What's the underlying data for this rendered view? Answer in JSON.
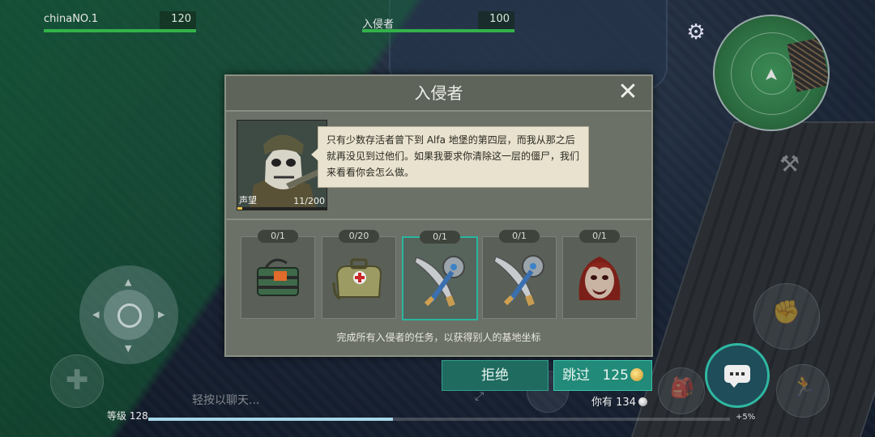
{
  "hud": {
    "player_name": "chinaNO.1",
    "player_hp": "120",
    "enemy_name": "入侵者",
    "enemy_hp": "100"
  },
  "dialog": {
    "title": "入侵者",
    "close_icon": "close-icon",
    "reputation_label": "声望",
    "reputation_value": "11/200",
    "reputation_progress": 0.055,
    "message": "只有少数存活者曾下到 Alfa 地堡的第四层，而我从那之后就再没见到过他们。如果我要求你清除这一层的僵尸，我们来看看你会怎么做。",
    "tasks": [
      {
        "count": "0/1",
        "icon": "explosive-pack-icon"
      },
      {
        "count": "0/20",
        "icon": "medkit-bag-icon"
      },
      {
        "count": "0/1",
        "icon": "sawblade-machete-icon"
      },
      {
        "count": "0/1",
        "icon": "sawblade-machete-icon"
      },
      {
        "count": "0/1",
        "icon": "zombie-head-icon"
      }
    ],
    "footnote": "完成所有入侵者的任务，以获得别人的基地坐标"
  },
  "actions": {
    "reject_label": "拒绝",
    "skip_label": "跳过",
    "skip_cost": "125",
    "have_label": "你有",
    "have_value": "134"
  },
  "chat": {
    "placeholder": "轻按以聊天..."
  },
  "player": {
    "level_label": "等级",
    "level_value": "128",
    "xp_bonus": "+5%",
    "xp_progress": 0.42
  },
  "colors": {
    "accent": "#2fb8a2",
    "hp_bar": "#33b24a",
    "dialog_bg": "#6b7166"
  }
}
